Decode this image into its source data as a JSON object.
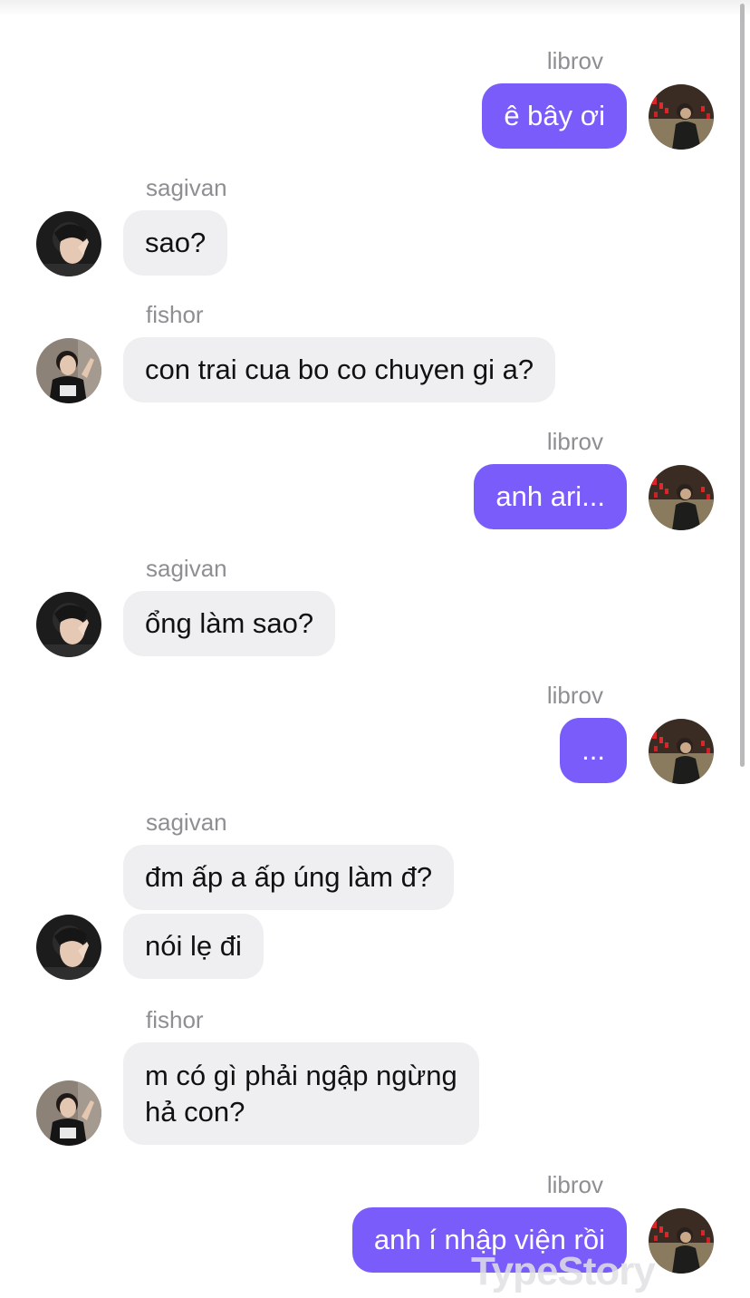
{
  "colors": {
    "outgoing_bubble": "#7a5cfa",
    "incoming_bubble": "#efeff2",
    "name_text": "#8e8e93"
  },
  "messages": [
    {
      "sender": "librov",
      "text": "ê bây ơi"
    },
    {
      "sender": "sagivan",
      "text": "sao?"
    },
    {
      "sender": "fishor",
      "text": "con trai cua bo co chuyen gi a?"
    },
    {
      "sender": "librov",
      "text": "anh ari..."
    },
    {
      "sender": "sagivan",
      "text": "ổng làm sao?"
    },
    {
      "sender": "librov",
      "text": "..."
    },
    {
      "sender": "sagivan",
      "text": "đm ấp a ấp úng làm đ?"
    },
    {
      "text": "nói lẹ đi"
    },
    {
      "sender": "fishor",
      "text": "m có gì phải ngập ngừng\nhả con?"
    },
    {
      "sender": "librov",
      "text": "anh í nhập viện rồi"
    }
  ],
  "watermark": "TypeStory"
}
